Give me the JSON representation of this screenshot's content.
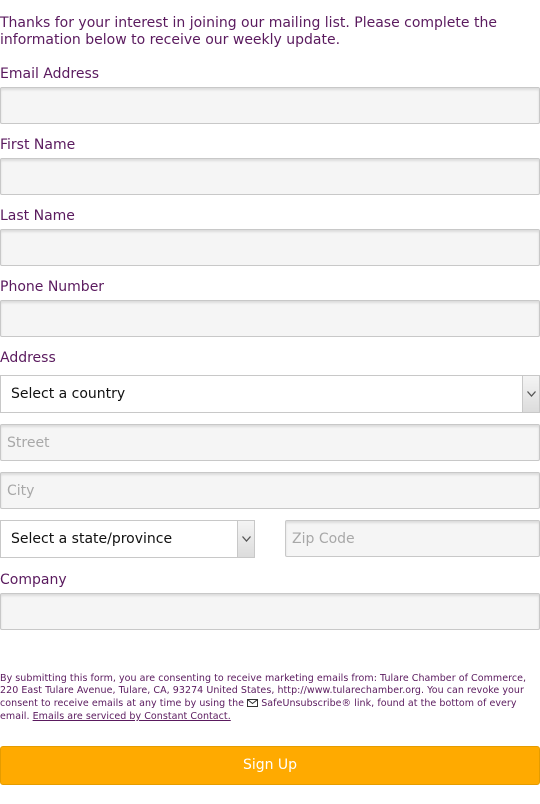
{
  "intro": "Thanks for your interest in joining our mailing list. Please complete the information below to receive our weekly update.",
  "fields": {
    "email": {
      "label": "Email Address",
      "value": ""
    },
    "first_name": {
      "label": "First Name",
      "value": ""
    },
    "last_name": {
      "label": "Last Name",
      "value": ""
    },
    "phone": {
      "label": "Phone Number",
      "value": ""
    },
    "address": {
      "label": "Address",
      "country_select": "Select a country",
      "street_placeholder": "Street",
      "city_placeholder": "City",
      "state_select": "Select a state/province",
      "zip_placeholder": "Zip Code"
    },
    "company": {
      "label": "Company",
      "value": ""
    }
  },
  "consent": {
    "text_before": "By submitting this form, you are consenting to receive marketing emails from: Tulare Chamber of Commerce, 220 East Tulare Avenue, Tulare, CA, 93274 United States, http://www.tularechamber.org. You can revoke your consent to receive emails at any time by using the ",
    "safeunsubscribe": "SafeUnsubscribe® link, found at the bottom of every email.",
    "link_text": "Emails are serviced by Constant Contact."
  },
  "submit_label": "Sign Up",
  "colors": {
    "text": "#5a1a5e",
    "button": "#ffaa00",
    "field_bg": "#f5f5f5"
  },
  "icons": {
    "envelope": "envelope-icon",
    "dropdown": "chevron-down-icon"
  }
}
